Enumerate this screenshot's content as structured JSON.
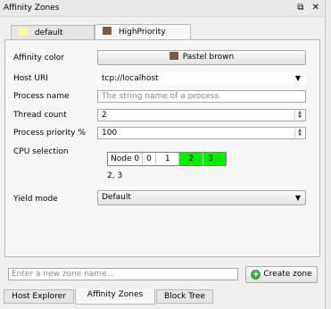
{
  "window": {
    "title": "Affinity Zones",
    "float_icon": "float-icon",
    "close_icon": "close-icon"
  },
  "tabs": [
    {
      "label": "default",
      "color": "#ffff99"
    },
    {
      "label": "HighPriority",
      "color": "#7b5b48"
    }
  ],
  "form": {
    "affinity_color_label": "Affinity color",
    "affinity_color_value": "Pastel brown",
    "affinity_color_hex": "#7b5b48",
    "host_uri_label": "Host URI",
    "host_uri_value": "tcp://localhost",
    "process_name_label": "Process name",
    "process_name_placeholder": "The string name of a process",
    "thread_count_label": "Thread count",
    "thread_count_value": "2",
    "process_priority_label": "Process priority %",
    "process_priority_value": "100",
    "cpu_selection_label": "CPU selection",
    "cpu_node_label": "Node 0",
    "cpu_cells": [
      {
        "label": "0",
        "selected": false
      },
      {
        "label": "1",
        "selected": false
      },
      {
        "label": "2",
        "selected": true
      },
      {
        "label": "3",
        "selected": true
      }
    ],
    "cpu_selected_text": "2, 3",
    "yield_mode_label": "Yield mode",
    "yield_mode_value": "Default"
  },
  "footer": {
    "new_zone_placeholder": "Enter a new zone name...",
    "create_zone_label": "Create zone",
    "create_zone_icon": "plus-icon"
  },
  "bottom_tabs": [
    {
      "label": "Host Explorer",
      "active": false
    },
    {
      "label": "Affinity Zones",
      "active": true
    },
    {
      "label": "Block Tree",
      "active": false
    }
  ]
}
